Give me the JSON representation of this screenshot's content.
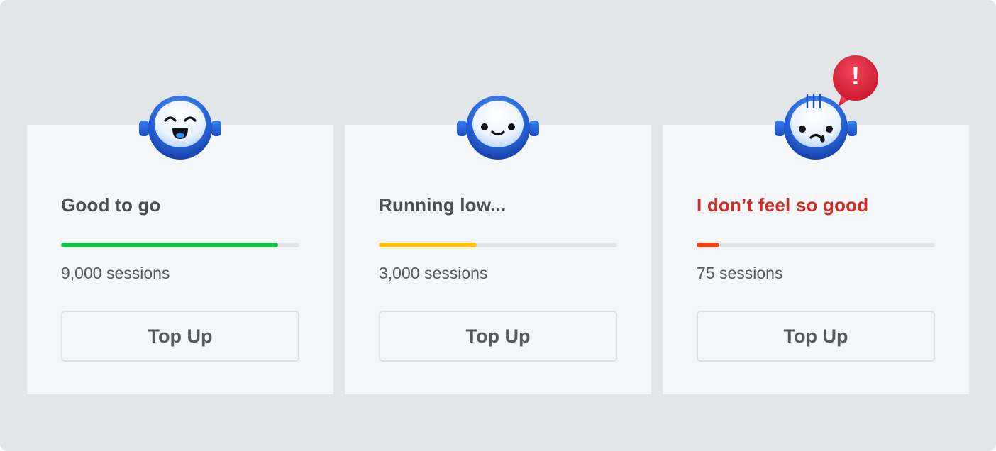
{
  "cards": [
    {
      "status": "Good to go",
      "sessions": "9,000 sessions",
      "level": 0.91,
      "bar_color": "#14c24a",
      "button_label": "Top Up",
      "mood": "happy"
    },
    {
      "status": "Running low...",
      "sessions": "3,000 sessions",
      "level": 0.41,
      "bar_color": "#ffc107",
      "button_label": "Top Up",
      "mood": "content"
    },
    {
      "status": "I don’t feel so good",
      "sessions": "75 sessions",
      "level": 0.095,
      "bar_color": "#f04512",
      "button_label": "Top Up",
      "mood": "sad",
      "alert": "!"
    }
  ],
  "colors": {
    "background": "#e3e6e9",
    "card": "#f5f6f8",
    "danger_text": "#d42a26",
    "robot_blue": "#1f5ed6",
    "alert_red": "#d81f36"
  },
  "icons": [
    "robot-happy-icon",
    "robot-content-icon",
    "robot-sad-icon",
    "alert-bubble-icon"
  ]
}
